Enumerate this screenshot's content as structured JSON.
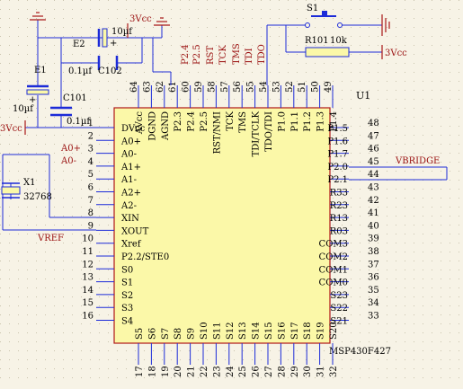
{
  "colors": {
    "background": "#f7f3e6",
    "wire": "#1c2bd8",
    "power": "#a81818",
    "body_outline": "#b01818",
    "chip_fill": "#fbf8a8",
    "text": "#000000",
    "net_label": "#9a1010"
  },
  "chip": {
    "ref": "U1",
    "part": "MSP430F427"
  },
  "pins_left": [
    {
      "num": "1",
      "name": "DVcc"
    },
    {
      "num": "2",
      "name": "A0+"
    },
    {
      "num": "3",
      "name": "A0-"
    },
    {
      "num": "4",
      "name": "A1+"
    },
    {
      "num": "5",
      "name": "A1-"
    },
    {
      "num": "6",
      "name": "A2+"
    },
    {
      "num": "7",
      "name": "A2-"
    },
    {
      "num": "8",
      "name": "XIN"
    },
    {
      "num": "9",
      "name": "XOUT"
    },
    {
      "num": "10",
      "name": "Xref"
    },
    {
      "num": "11",
      "name": "P2.2/STE0"
    },
    {
      "num": "12",
      "name": "S0"
    },
    {
      "num": "13",
      "name": "S1"
    },
    {
      "num": "14",
      "name": "S2"
    },
    {
      "num": "15",
      "name": "S3"
    },
    {
      "num": "16",
      "name": "S4"
    }
  ],
  "pins_right": [
    {
      "num": "48",
      "name": "P1.5"
    },
    {
      "num": "47",
      "name": "P1.6"
    },
    {
      "num": "46",
      "name": "P1.7"
    },
    {
      "num": "45",
      "name": "P2.0"
    },
    {
      "num": "44",
      "name": "P2.1"
    },
    {
      "num": "43",
      "name": "R33"
    },
    {
      "num": "42",
      "name": "R23"
    },
    {
      "num": "41",
      "name": "R13"
    },
    {
      "num": "40",
      "name": "R03"
    },
    {
      "num": "39",
      "name": "COM3"
    },
    {
      "num": "38",
      "name": "COM2"
    },
    {
      "num": "37",
      "name": "COM1"
    },
    {
      "num": "36",
      "name": "COM0"
    },
    {
      "num": "35",
      "name": "S23"
    },
    {
      "num": "34",
      "name": "S22"
    },
    {
      "num": "33",
      "name": "S21"
    }
  ],
  "pins_top": [
    {
      "num": "64",
      "name": "AVcc"
    },
    {
      "num": "63",
      "name": "DGND"
    },
    {
      "num": "62",
      "name": "AGND"
    },
    {
      "num": "61",
      "name": "P2.3"
    },
    {
      "num": "60",
      "name": "P2.4"
    },
    {
      "num": "59",
      "name": "P2.5"
    },
    {
      "num": "58",
      "name": "RST/NMI"
    },
    {
      "num": "57",
      "name": "TCK"
    },
    {
      "num": "56",
      "name": "TMS"
    },
    {
      "num": "55",
      "name": "TDI/TCLK"
    },
    {
      "num": "54",
      "name": "TDO/TDI"
    },
    {
      "num": "53",
      "name": "P1.0"
    },
    {
      "num": "52",
      "name": "P1.1"
    },
    {
      "num": "51",
      "name": "P1.2"
    },
    {
      "num": "50",
      "name": "P1.3"
    },
    {
      "num": "49",
      "name": "P1.4"
    }
  ],
  "pins_bottom": [
    {
      "num": "17",
      "name": "S5"
    },
    {
      "num": "18",
      "name": "S6"
    },
    {
      "num": "19",
      "name": "S7"
    },
    {
      "num": "20",
      "name": "S8"
    },
    {
      "num": "21",
      "name": "S9"
    },
    {
      "num": "22",
      "name": "S10"
    },
    {
      "num": "23",
      "name": "S11"
    },
    {
      "num": "24",
      "name": "S12"
    },
    {
      "num": "25",
      "name": "S13"
    },
    {
      "num": "26",
      "name": "S14"
    },
    {
      "num": "27",
      "name": "S15"
    },
    {
      "num": "28",
      "name": "S16"
    },
    {
      "num": "29",
      "name": "S17"
    },
    {
      "num": "30",
      "name": "S18"
    },
    {
      "num": "31",
      "name": "S19"
    },
    {
      "num": "32",
      "name": "S20"
    }
  ],
  "net_labels": {
    "p24": "P2.4",
    "p25": "P2.5",
    "rst": "RST",
    "tck": "TCK",
    "tms": "TMS",
    "tdi": "TDI",
    "tdo": "TDO",
    "a0p": "A0+",
    "a0m": "A0-",
    "vref": "VREF",
    "vbridge": "VBRIDGE",
    "vcc_top": "3Vcc",
    "vcc_left": "3Vcc",
    "vcc_right": "3Vcc"
  },
  "components": {
    "e2_ref": "E2",
    "e2_val": "10µf",
    "e2_plus": "+",
    "c102_val": "0.1µf",
    "c102_ref": "C102",
    "e1_ref": "E1",
    "e1_val": "10µf",
    "e1_plus": "+",
    "c101_ref": "C101",
    "c101_val": "0.1µf",
    "x1_ref": "X1",
    "x1_val": "32768",
    "s1_ref": "S1",
    "r101_ref": "R101",
    "r101_val": "10k"
  }
}
